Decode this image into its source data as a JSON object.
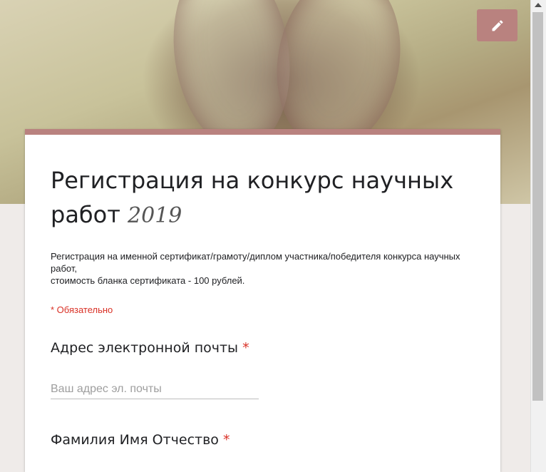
{
  "theme": {
    "accent": "#b9827f",
    "required_color": "#d93025"
  },
  "header": {
    "edit_icon": "pencil-icon"
  },
  "form": {
    "title_main": "Регистрация на конкурс научных работ",
    "title_year": "2019",
    "description_line1": "Регистрация на именной сертификат/грамоту/диплом участника/победителя конкурса научных работ,",
    "description_line2": "стоимость бланка сертификата - 100 рублей.",
    "required_note": "* Обязательно"
  },
  "questions": [
    {
      "label": "Адрес электронной почты",
      "required_mark": "*",
      "placeholder": "Ваш адрес эл. почты"
    },
    {
      "label": "Фамилия Имя Отчество",
      "required_mark": "*"
    }
  ]
}
